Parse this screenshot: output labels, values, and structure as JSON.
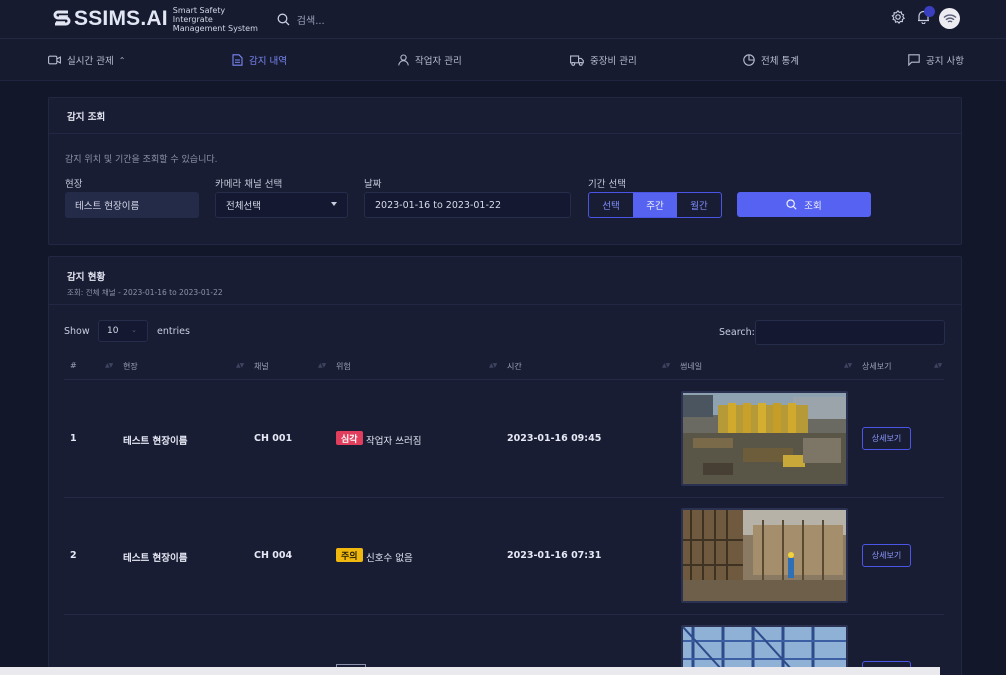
{
  "app": {
    "logo_text": "SSIMS.AI",
    "logo_sub_line1": "Smart Safety Intergrate",
    "logo_sub_line2": "Management System",
    "search_placeholder": "검색..."
  },
  "nav": [
    {
      "label": "실시간 관제",
      "icon": "camera-icon",
      "has_caret": true
    },
    {
      "label": "감지 내역",
      "icon": "document-icon",
      "active": true
    },
    {
      "label": "작업자 관리",
      "icon": "user-icon"
    },
    {
      "label": "중장비 관리",
      "icon": "truck-icon"
    },
    {
      "label": "전체 통계",
      "icon": "pie-chart-icon"
    },
    {
      "label": "공지 사항",
      "icon": "message-icon"
    }
  ],
  "filter": {
    "title": "감지 조회",
    "description": "감지 위치 및 기간을 조회할 수 있습니다.",
    "site_label": "현장",
    "site_value": "테스트 현장이름",
    "channel_label": "카메라 채널 선택",
    "channel_value": "전체선택",
    "date_label": "날짜",
    "date_value": "2023-01-16 to 2023-01-22",
    "period_label": "기간 선택",
    "period_options": [
      "선택",
      "주간",
      "월간"
    ],
    "period_selected": "주간",
    "search_button": "조회"
  },
  "status": {
    "title": "감지 현황",
    "subtitle": "조회: 전체 채널 - 2023-01-16 to 2023-01-22",
    "show_label": "Show",
    "entries_value": "10",
    "entries_label": "entries",
    "search_label": "Search:",
    "columns": [
      "#",
      "현장",
      "채널",
      "위험",
      "시간",
      "썸네일",
      "상세보기"
    ],
    "rows": [
      {
        "no": "1",
        "site": "테스트 현장이름",
        "channel": "CH 001",
        "level": "심각",
        "level_color": "#e13e5e",
        "event": "작업자 쓰러짐",
        "time": "2023-01-16 09:45",
        "detail": "상세보기"
      },
      {
        "no": "2",
        "site": "테스트 현장이름",
        "channel": "CH 004",
        "level": "주의",
        "level_color": "#f0b80f",
        "event": "신호수 없음",
        "time": "2023-01-16 07:31",
        "detail": "상세보기"
      }
    ]
  },
  "colors": {
    "accent": "#5662f2",
    "background": "#13172a",
    "panel": "#181d33"
  }
}
